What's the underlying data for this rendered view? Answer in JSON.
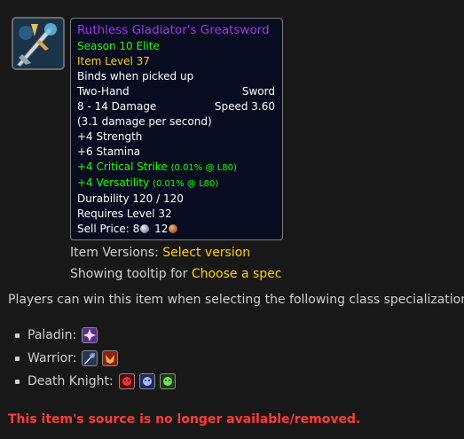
{
  "item": {
    "icon": "greatsword-item-icon",
    "name": "Ruthless Gladiator's Greatsword",
    "season": "Season 10 Elite",
    "item_level": "Item Level 37",
    "binds": "Binds when picked up",
    "slot": "Two-Hand",
    "type": "Sword",
    "damage": "8 - 14 Damage",
    "speed": "Speed 3.60",
    "dps": "(3.1 damage per second)",
    "strength": "+4 Strength",
    "stamina": "+6 Stamina",
    "crit": "+4 Critical Strike",
    "crit_note": "(0.01% @ L80)",
    "versatility": "+4 Versatility",
    "versatility_note": "(0.01% @ L80)",
    "durability": "Durability 120 / 120",
    "requires": "Requires Level 32",
    "sell_label": "Sell Price:",
    "sell_silver": "8",
    "sell_copper": "12",
    "colors": {
      "epic": "#a335ee",
      "uncommon": "#1eff00",
      "gold": "#ffd100"
    }
  },
  "versions": {
    "label": "Item Versions:",
    "link": "Select version"
  },
  "tooltip_spec": {
    "label": "Showing tooltip for",
    "link": "Choose a spec"
  },
  "description": "Players can win this item when selecting the following class specializations:",
  "classes": [
    {
      "label": "Paladin:",
      "specs": [
        "retribution-spec-icon"
      ]
    },
    {
      "label": "Warrior:",
      "specs": [
        "arms-spec-icon",
        "fury-spec-icon"
      ]
    },
    {
      "label": "Death Knight:",
      "specs": [
        "blood-spec-icon",
        "frost-spec-icon",
        "unholy-spec-icon"
      ]
    }
  ],
  "warning": "This item's source is no longer available/removed."
}
